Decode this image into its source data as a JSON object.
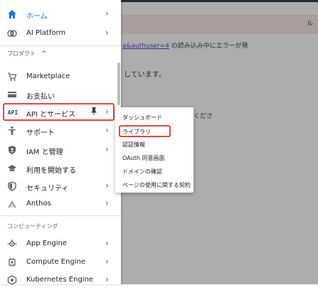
{
  "background": {
    "banner_text": "ル",
    "error_line_link": "a&authuser=4",
    "error_line_text": " の読み込み中にエラーが発",
    "line2": "しています。",
    "line3": "くださ"
  },
  "sidebar": {
    "home": {
      "label": "ホーム"
    },
    "ai_platform": {
      "label": "AI Platform"
    },
    "section_products": {
      "label": "プロダクト",
      "caret": "^"
    },
    "marketplace": {
      "label": "Marketplace"
    },
    "billing": {
      "label": "お支払い"
    },
    "api": {
      "icon_text": "API",
      "label": "API とサービス"
    },
    "support": {
      "label": "サポート"
    },
    "iam": {
      "label": "IAM と管理"
    },
    "getting_started": {
      "label": "利用を開始する"
    },
    "security": {
      "label": "セキュリティ"
    },
    "anthos": {
      "label": "Anthos"
    },
    "section_compute": {
      "label": "コンピューティング"
    },
    "app_engine": {
      "label": "App Engine"
    },
    "compute_engine": {
      "label": "Compute Engine"
    },
    "kubernetes": {
      "label": "Kubernetes Engine"
    }
  },
  "submenu": {
    "items": [
      "ダッシュボード",
      "ライブラリ",
      "認証情報",
      "OAuth 同意画面",
      "ドメインの確認",
      "ページの使用に関する契約"
    ]
  },
  "colors": {
    "accent": "#1a73e8",
    "highlight": "#e8453c",
    "overlay": "rgba(0,0,0,0.32)"
  }
}
